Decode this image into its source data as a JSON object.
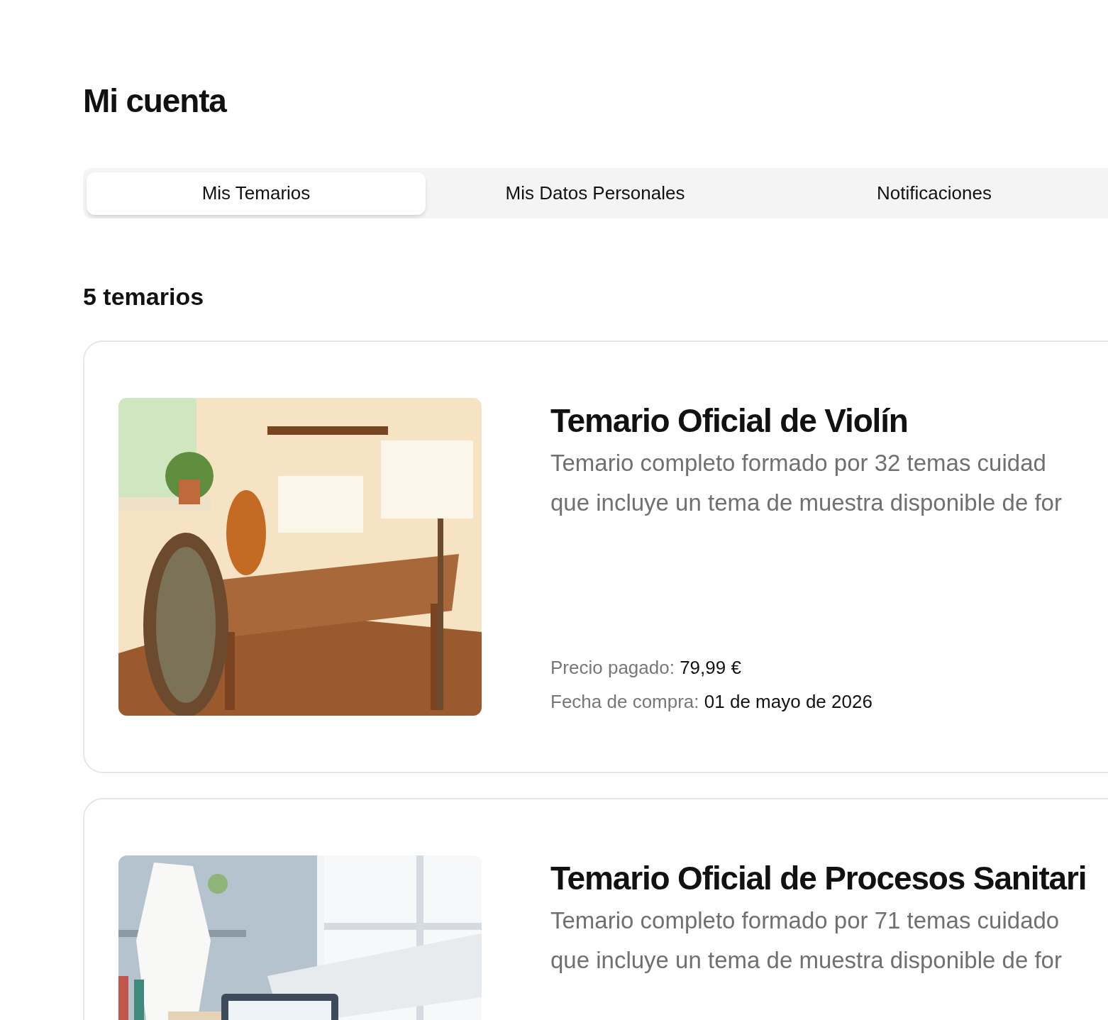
{
  "page_title": "Mi cuenta",
  "tabs": [
    {
      "label": "Mis Temarios",
      "selected": true
    },
    {
      "label": "Mis Datos Personales",
      "selected": false
    },
    {
      "label": "Notificaciones",
      "selected": false
    }
  ],
  "count_label": "5 temarios",
  "courses": [
    {
      "image": {
        "kind": "picture"
      },
      "title": "Temario Oficial de Violín",
      "description_lines": [
        "Temario completo formado por 32 temas cuidad",
        "que incluye un tema de muestra disponible de for"
      ],
      "price_label": "Precio pagado:",
      "price": "79,99 €",
      "date_label": "Fecha de compra:",
      "date": "01 de mayo de 2026"
    },
    {
      "image": {
        "kind": "picture"
      },
      "title": "Temario Oficial de Procesos Sanitari",
      "description_lines": [
        "Temario completo formado por 71 temas cuidado",
        "que incluye un tema de muestra disponible de for"
      ]
    }
  ]
}
